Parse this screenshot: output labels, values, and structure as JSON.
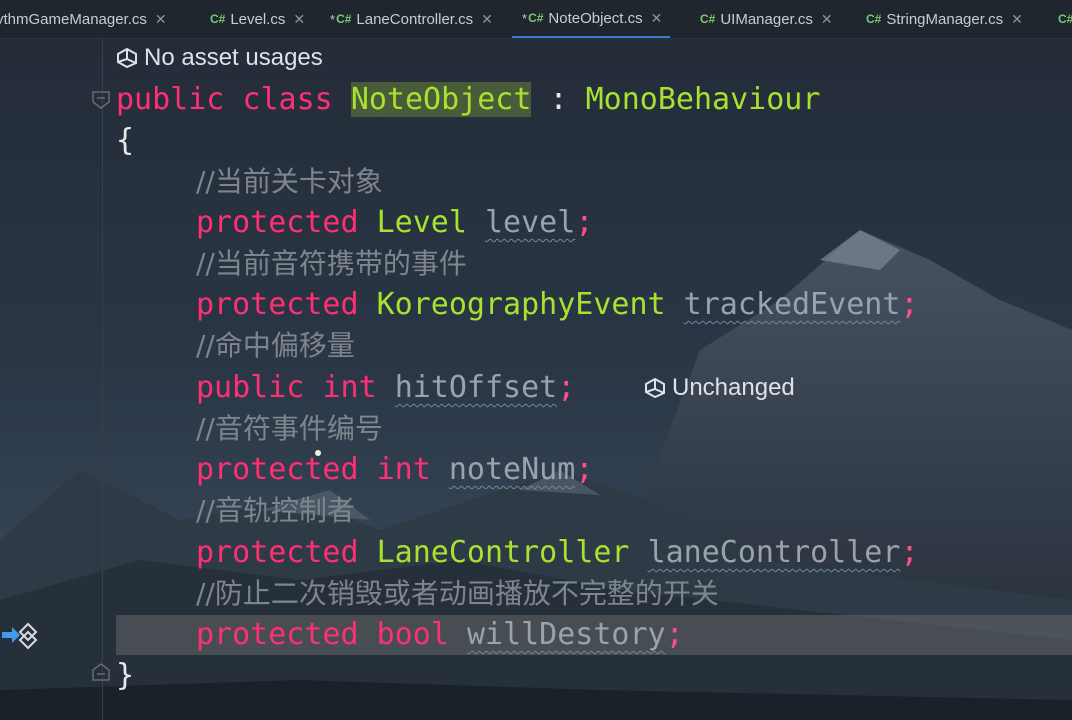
{
  "tabs": [
    {
      "name": "ythmGameManager.cs",
      "modified": false,
      "active": false,
      "show_icon": false
    },
    {
      "name": "Level.cs",
      "modified": false,
      "active": false,
      "show_icon": true
    },
    {
      "name": "LaneController.cs",
      "modified": true,
      "active": false,
      "show_icon": true
    },
    {
      "name": "NoteObject.cs",
      "modified": true,
      "active": true,
      "show_icon": true
    },
    {
      "name": "UIManager.cs",
      "modified": false,
      "active": false,
      "show_icon": true
    },
    {
      "name": "StringManager.cs",
      "modified": false,
      "active": false,
      "show_icon": true
    }
  ],
  "tab_icon_label": "C#",
  "tab_modified_mark": "*",
  "hints": {
    "asset_usages": "No asset usages",
    "unchanged": "Unchanged"
  },
  "code": {
    "line1": {
      "kw1": "public",
      "kw2": "class",
      "name": "NoteObject",
      "colon": ":",
      "base": "MonoBehaviour"
    },
    "open_brace": "{",
    "c_level": "//当前关卡对象",
    "l_level": {
      "kw": "protected",
      "type": "Level",
      "name": "level",
      "semi": ";"
    },
    "c_event": "//当前音符携带的事件",
    "l_event": {
      "kw": "protected",
      "type": "KoreographyEvent",
      "name": "trackedEvent",
      "semi": ";"
    },
    "c_offset": "//命中偏移量",
    "l_offset": {
      "kw": "public",
      "type": "int",
      "name": "hitOffset",
      "semi": ";"
    },
    "c_num": "//音符事件编号",
    "l_num": {
      "kw": "protected",
      "type": "int",
      "name": "noteNum",
      "semi": ";"
    },
    "c_lane": "//音轨控制者",
    "l_lane": {
      "kw": "protected",
      "type": "LaneController",
      "name": "laneController",
      "semi": ";"
    },
    "c_destroy": "//防止二次销毁或者动画播放不完整的开关",
    "l_destroy": {
      "kw": "protected",
      "type": "bool",
      "name": "willDestory",
      "semi": ";"
    },
    "close_brace": "}"
  },
  "colors": {
    "keyword": "#ff2f74",
    "type": "#a6e22e",
    "comment": "#7f858d",
    "field": "#9aa2ab",
    "tab_icon": "#7ec86f",
    "active_tab_underline": "#3d7ad6"
  }
}
